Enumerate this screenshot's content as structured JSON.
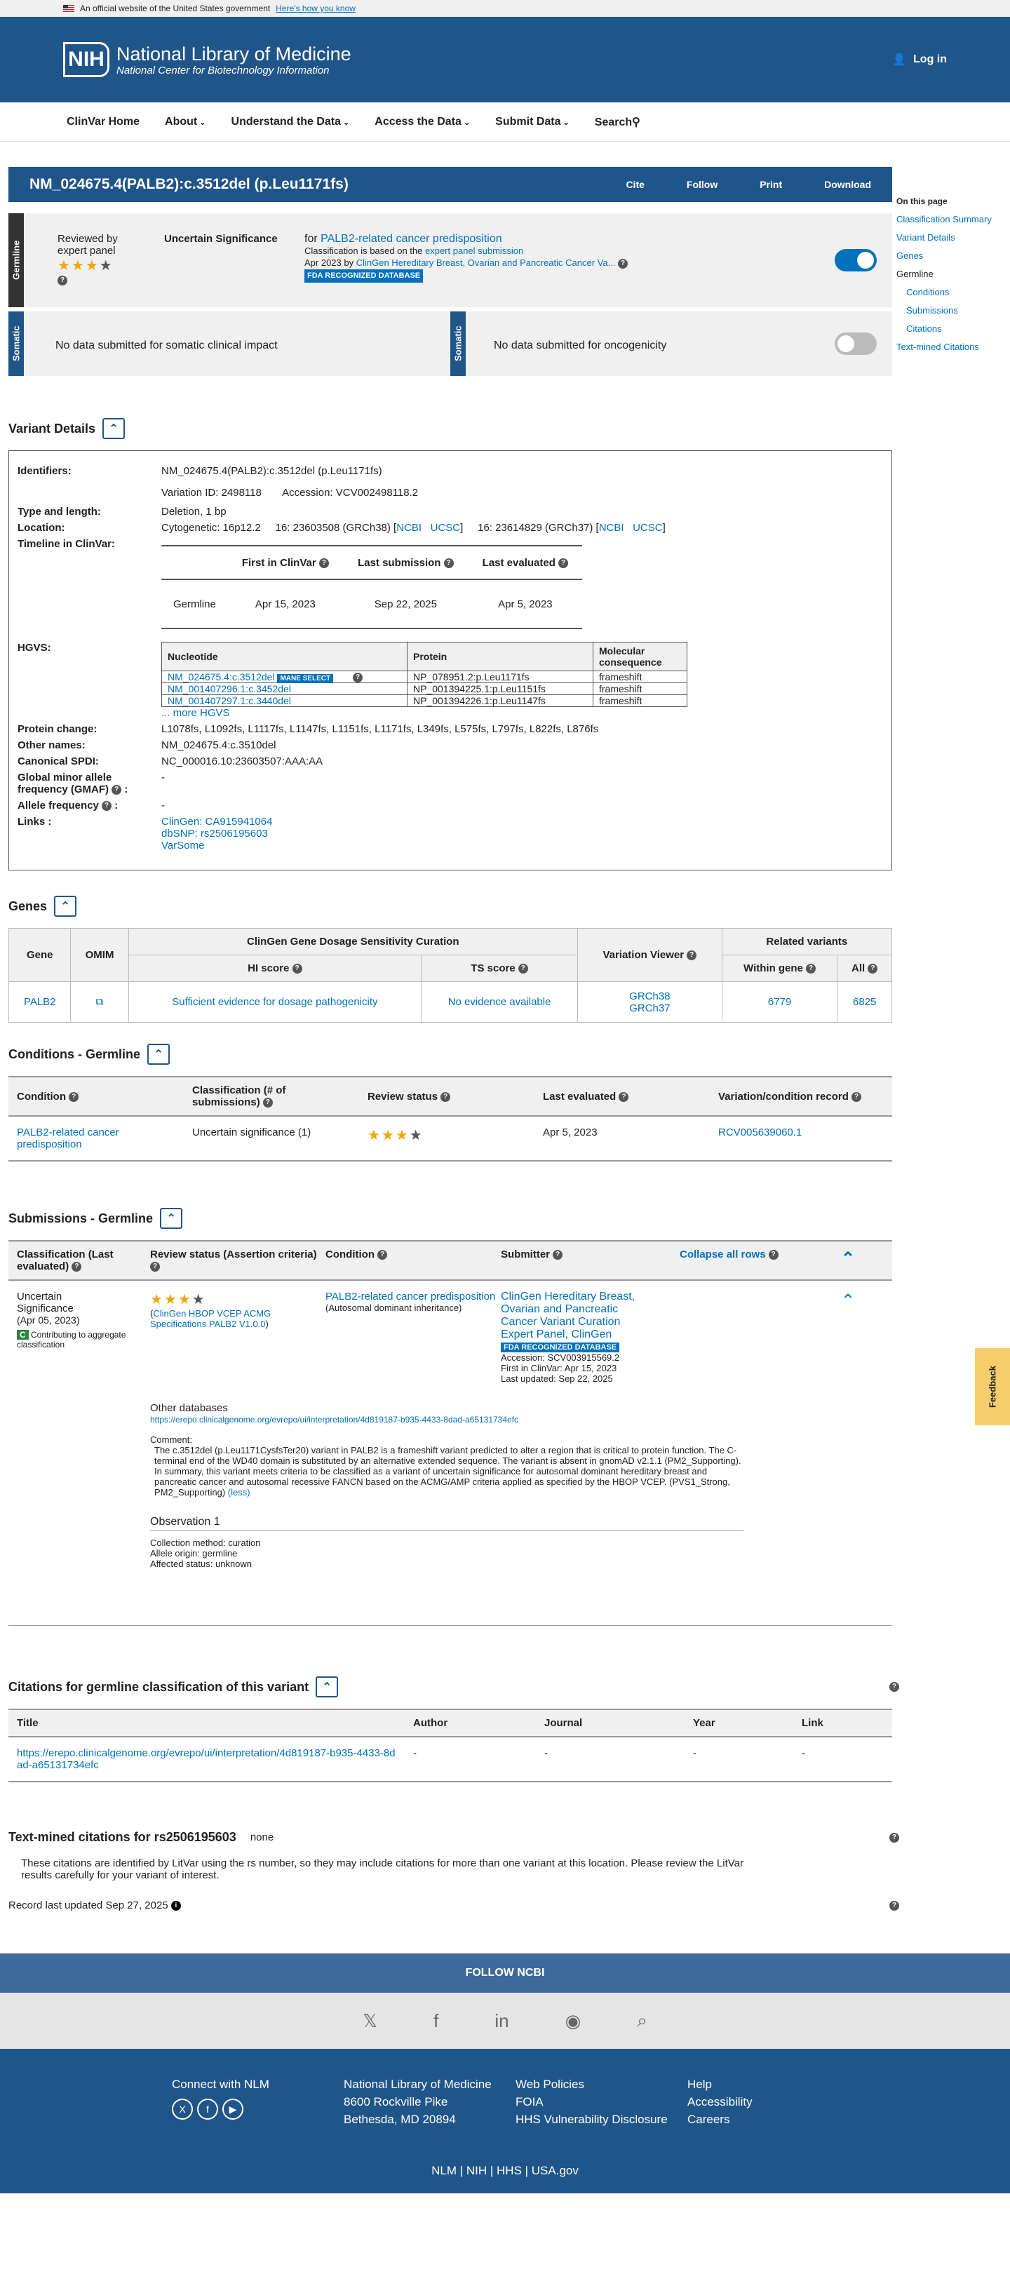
{
  "gov": {
    "text": "An official website of the United States government",
    "link": "Here's how you know"
  },
  "header": {
    "logo_box": "NIH",
    "title": "National Library of Medicine",
    "subtitle": "National Center for Biotechnology Information",
    "login": "Log in"
  },
  "nav": [
    "ClinVar Home",
    "About",
    "Understand the Data",
    "Access the Data",
    "Submit Data",
    "Search"
  ],
  "side": {
    "title": "On this page",
    "items": [
      "Classification Summary",
      "Variant Details",
      "Genes",
      "Germline",
      "Conditions",
      "Submissions",
      "Citations",
      "Text-mined Citations"
    ]
  },
  "variant": {
    "title": "NM_024675.4(PALB2):c.3512del (p.Leu1171fs)",
    "actions": [
      "Cite",
      "Follow",
      "Print",
      "Download"
    ]
  },
  "germline": {
    "label": "Germline",
    "reviewed": "Reviewed by expert panel",
    "classification": "Uncertain Significance",
    "for": "for ",
    "condition": "PALB2-related cancer predisposition",
    "basis": "Classification is based on the ",
    "basis_link": "expert panel submission",
    "date": "Apr 2023 by ",
    "submitter": "ClinGen Hereditary Breast, Ovarian and Pancreatic Cancer Va...",
    "fda": "FDA RECOGNIZED DATABASE"
  },
  "somatic": {
    "label": "Somatic",
    "clinical": "No data submitted for somatic clinical impact",
    "onco": "No data submitted for oncogenicity"
  },
  "details": {
    "heading": "Variant Details",
    "identifiers_k": "Identifiers:",
    "identifiers": "NM_024675.4(PALB2):c.3512del (p.Leu1171fs)",
    "variation_id": "Variation ID: 2498118",
    "accession": "Accession: VCV002498118.2",
    "type_k": "Type and length:",
    "type": "Deletion, 1 bp",
    "location_k": "Location:",
    "location": "Cytogenetic: 16p12.2     16: 23603508 (GRCh38) [",
    "ncbi": "NCBI",
    "ucsc": "UCSC",
    "location2": "]     16: 23614829 (GRCh37) [",
    "timeline_k": "Timeline in ClinVar:",
    "timeline_h": [
      "First in ClinVar",
      "Last submission",
      "Last evaluated"
    ],
    "timeline_row": [
      "Germline",
      "Apr 15, 2023",
      "Sep 22, 2025",
      "Apr 5, 2023"
    ],
    "hgvs_k": "HGVS:",
    "hgvs_h": [
      "Nucleotide",
      "Protein",
      "Molecular consequence"
    ],
    "hgvs": [
      [
        "NM_024675.4:c.3512del",
        "NP_078951.2:p.Leu1171fs",
        "frameshift"
      ],
      [
        "NM_001407296.1:c.3452del",
        "NP_001394225.1:p.Leu1151fs",
        "frameshift"
      ],
      [
        "NM_001407297.1:c.3440del",
        "NP_001394226.1:p.Leu1147fs",
        "frameshift"
      ]
    ],
    "mane": "MANE SELECT",
    "more": "... more HGVS",
    "protein_k": "Protein change:",
    "protein": "L1078fs, L1092fs, L1117fs, L1147fs, L1151fs, L1171fs, L349fs, L575fs, L797fs, L822fs, L876fs",
    "other_k": "Other names:",
    "other": "NM_024675.4:c.3510del",
    "spdi_k": "Canonical SPDI:",
    "spdi": "NC_000016.10:23603507:AAA:AA",
    "gmaf_k": "Global minor allele frequency (GMAF)",
    "gmaf": "-",
    "af_k": "Allele frequency",
    "af": "-",
    "links_k": "Links :",
    "links": [
      "ClinGen: CA915941064",
      "dbSNP: rs2506195603",
      "VarSome"
    ]
  },
  "genes": {
    "heading": "Genes",
    "h1": [
      "Gene",
      "OMIM",
      "ClinGen Gene Dosage Sensitivity Curation",
      "Variation Viewer",
      "Related variants"
    ],
    "h2": [
      "HI score",
      "TS score",
      "Within gene",
      "All"
    ],
    "gene": "PALB2",
    "hi": "Sufficient evidence for dosage pathogenicity",
    "ts": "No evidence available",
    "viewer": [
      "GRCh38",
      "GRCh37"
    ],
    "within": "6779",
    "all": "6825"
  },
  "conditions": {
    "heading": "Conditions - Germline",
    "h": [
      "Condition",
      "Classification (# of submissions)",
      "Review status",
      "Last evaluated",
      "Variation/condition record"
    ],
    "row": [
      "PALB2-related cancer predisposition",
      "Uncertain significance (1)",
      "",
      "Apr 5, 2023",
      "RCV005639060.1"
    ]
  },
  "submissions": {
    "heading": "Submissions - Germline",
    "h": [
      "Classification (Last evaluated)",
      "Review status (Assertion criteria)",
      "Condition",
      "Submitter"
    ],
    "collapse": "Collapse all rows",
    "class": "Uncertain Significance",
    "date": "(Apr 05, 2023)",
    "contrib": "Contributing to aggregate classification",
    "criteria": "ClinGen HBOP VCEP ACMG Specifications PALB2 V1.0.0",
    "cond": "PALB2-related cancer predisposition",
    "inherit": "(Autosomal dominant inheritance)",
    "submitter": "ClinGen Hereditary Breast, Ovarian and Pancreatic Cancer Variant Curation Expert Panel, ClinGen",
    "fda": "FDA RECOGNIZED DATABASE",
    "acc": "Accession: SCV003915569.2",
    "first": "First in ClinVar: Apr 15, 2023",
    "updated": "Last updated: Sep 22, 2025",
    "otherdb": "Other databases",
    "url": "https://erepo.clinicalgenome.org/evrepo/ui/interpretation/4d819187-b935-4433-8dad-a65131734efc",
    "comment_k": "Comment:",
    "comment": "The c.3512del (p.Leu1171CysfsTer20) variant in PALB2 is a frameshift variant predicted to alter a region that is critical to protein function. The C-terminal end of the WD40 domain is substituted by an alternative extended sequence. The variant is absent in gnomAD v2.1.1 (PM2_Supporting). In summary, this variant meets criteria to be classified as a variant of uncertain significance for autosomal dominant hereditary breast and pancreatic cancer and autosomal recessive FANCN based on the ACMG/AMP criteria applied as specified by the HBOP VCEP. (PVS1_Strong, PM2_Supporting)",
    "less": "(less)",
    "obs": "Observation 1",
    "method": "Collection method: curation",
    "origin": "Allele origin: germline",
    "affected": "Affected status: unknown"
  },
  "citations": {
    "heading": "Citations for germline classification of this variant",
    "h": [
      "Title",
      "Author",
      "Journal",
      "Year",
      "Link"
    ],
    "row": [
      "https://erepo.clinicalgenome.org/evrepo/ui/interpretation/4d819187-b935-4433-8dad-a65131734efc",
      "-",
      "-",
      "-",
      "-"
    ]
  },
  "textmined": {
    "heading": "Text-mined citations for rs2506195603",
    "none": "none",
    "note": "These citations are identified by LitVar using the rs number, so they may include citations for more than one variant at this location. Please review the LitVar results carefully for your variant of interest."
  },
  "record": "Record last updated Sep 27, 2025",
  "feedback": "Feedback",
  "footer": {
    "follow": "FOLLOW NCBI",
    "connect": "Connect with NLM",
    "nlm": [
      "National Library of Medicine",
      "8600 Rockville Pike",
      "Bethesda, MD 20894"
    ],
    "policies": [
      "Web Policies",
      "FOIA",
      "HHS Vulnerability Disclosure"
    ],
    "help": [
      "Help",
      "Accessibility",
      "Careers"
    ],
    "bottom": "NLM | NIH | HHS | USA.gov"
  }
}
